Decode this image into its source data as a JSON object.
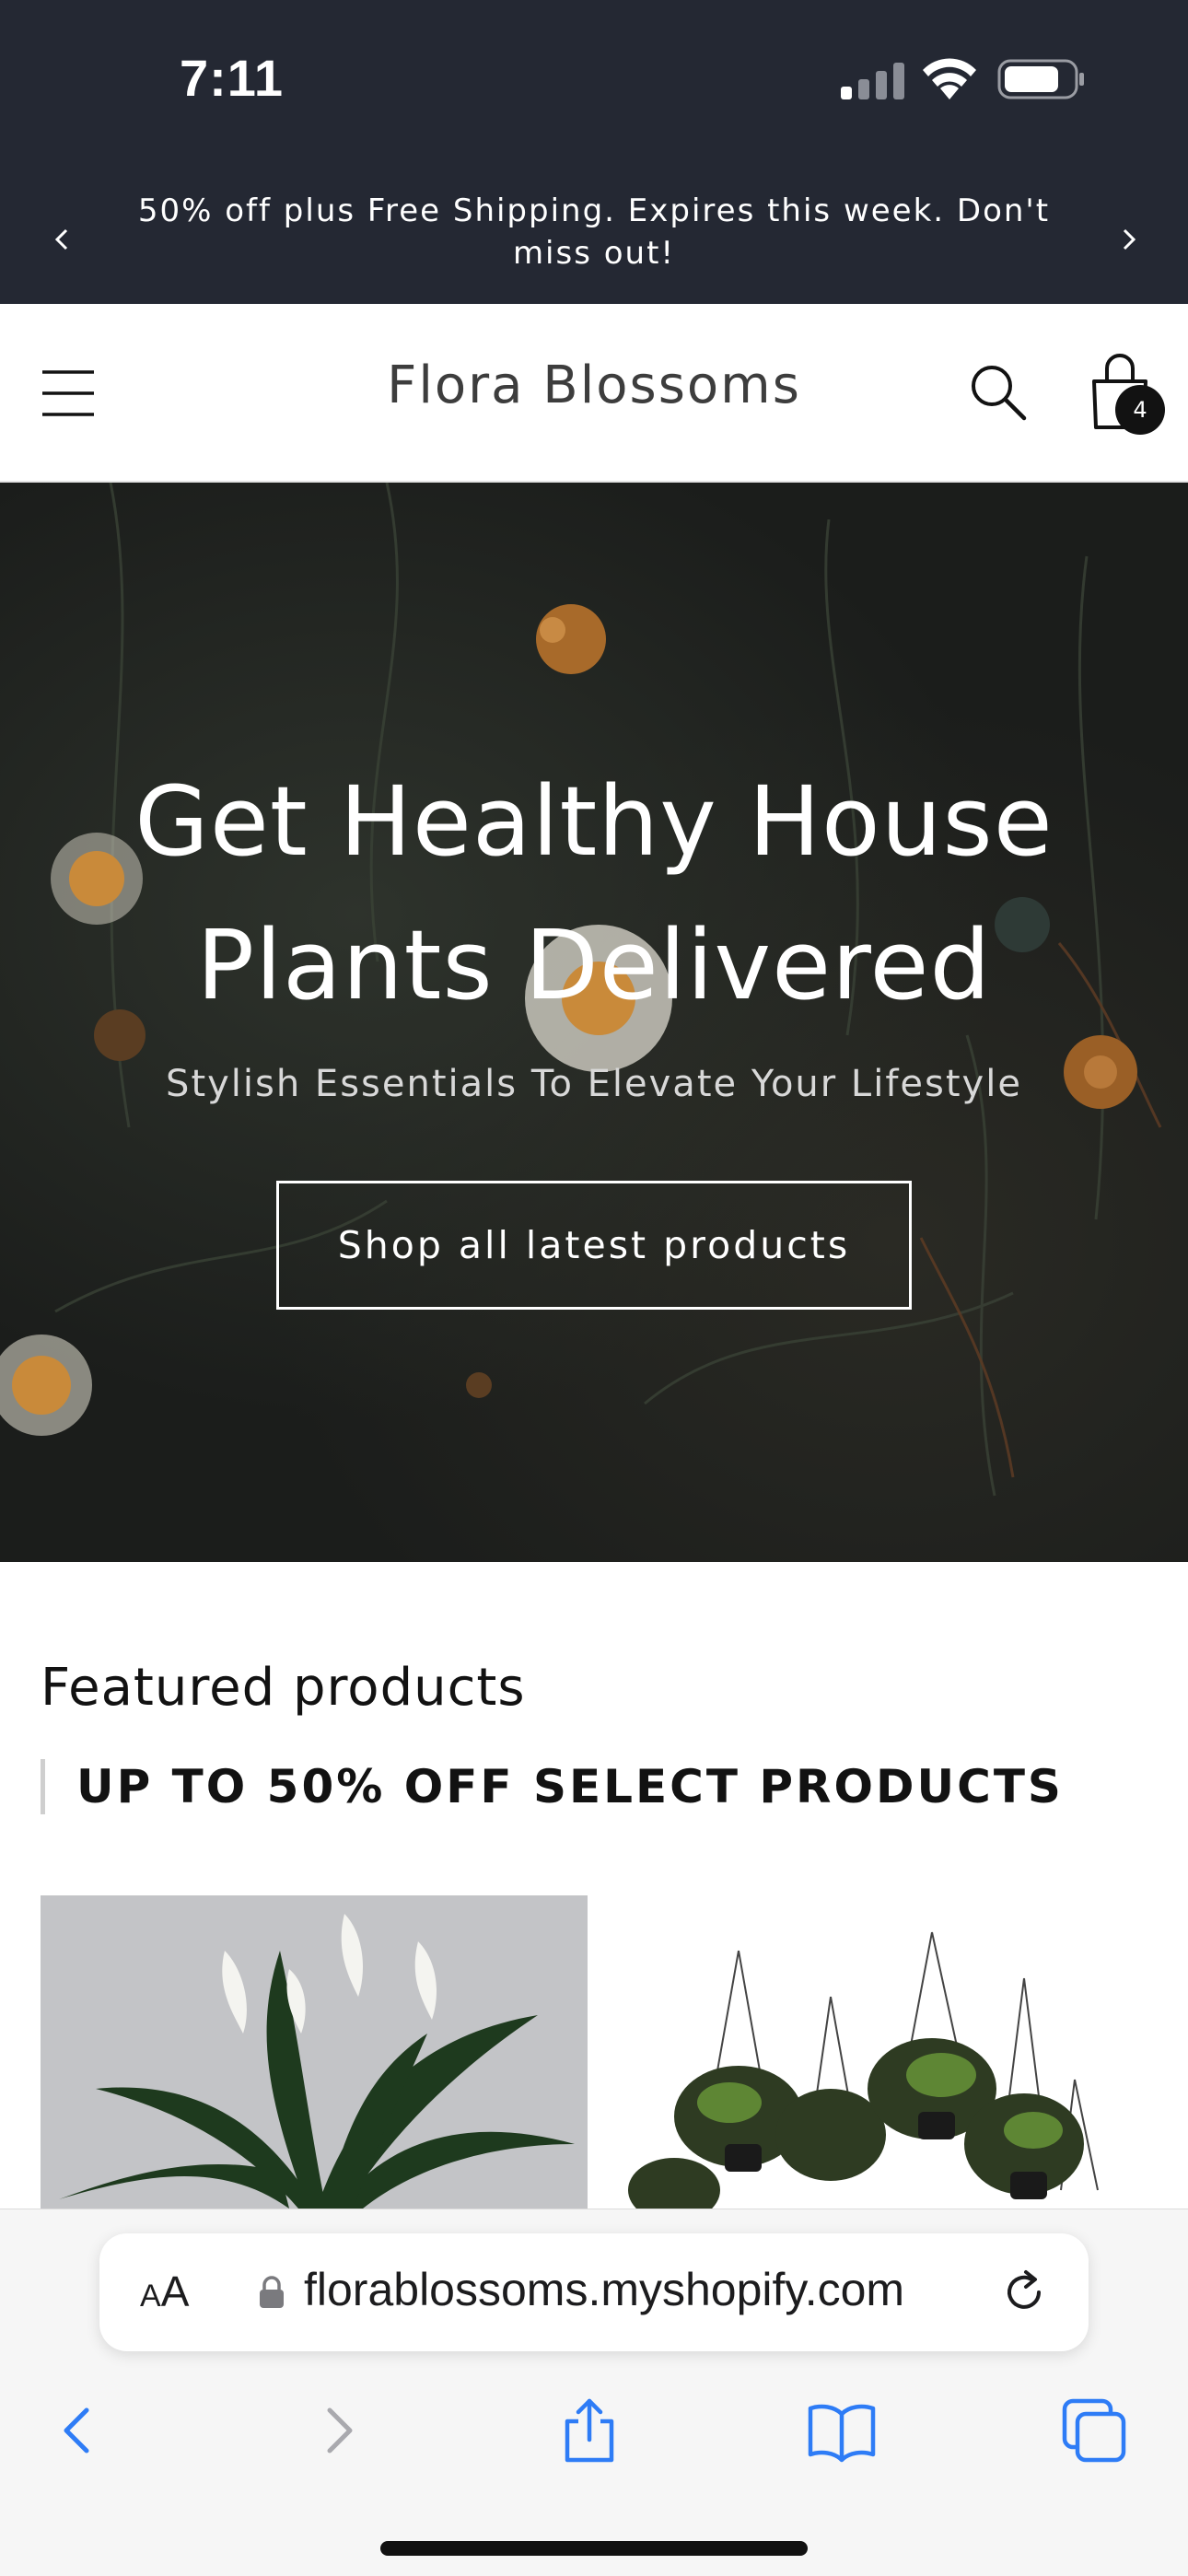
{
  "status_bar": {
    "time": "7:11",
    "signal_icon": "cellular-signal-icon",
    "wifi_icon": "wifi-icon",
    "battery_icon": "battery-icon"
  },
  "announcement": {
    "text": "50% off plus Free Shipping. Expires this week. Don't miss out!",
    "prev_icon": "chevron-left-icon",
    "next_icon": "chevron-right-icon"
  },
  "header": {
    "store_name": "Flora Blossoms",
    "menu_icon": "hamburger-menu-icon",
    "search_icon": "search-icon",
    "cart_icon": "shopping-bag-icon",
    "cart_count": "4"
  },
  "hero": {
    "title": "Get Healthy House Plants Delivered",
    "subtitle": "Stylish Essentials To Elevate Your Lifestyle",
    "button_label": "Shop all latest products"
  },
  "featured": {
    "heading": "Featured products",
    "subheading": "UP TO 50% OFF SELECT PRODUCTS"
  },
  "browser": {
    "text_size_label": "AA",
    "url": "florablossoms.myshopify.com",
    "lock_icon": "lock-icon",
    "reload_icon": "reload-icon",
    "toolbar_icons": [
      "back-icon",
      "forward-icon",
      "share-icon",
      "bookmarks-icon",
      "tabs-icon"
    ]
  },
  "colors": {
    "header_dark": "#242833",
    "accent_blue": "#2e7cf6",
    "text_dark": "#121212"
  }
}
